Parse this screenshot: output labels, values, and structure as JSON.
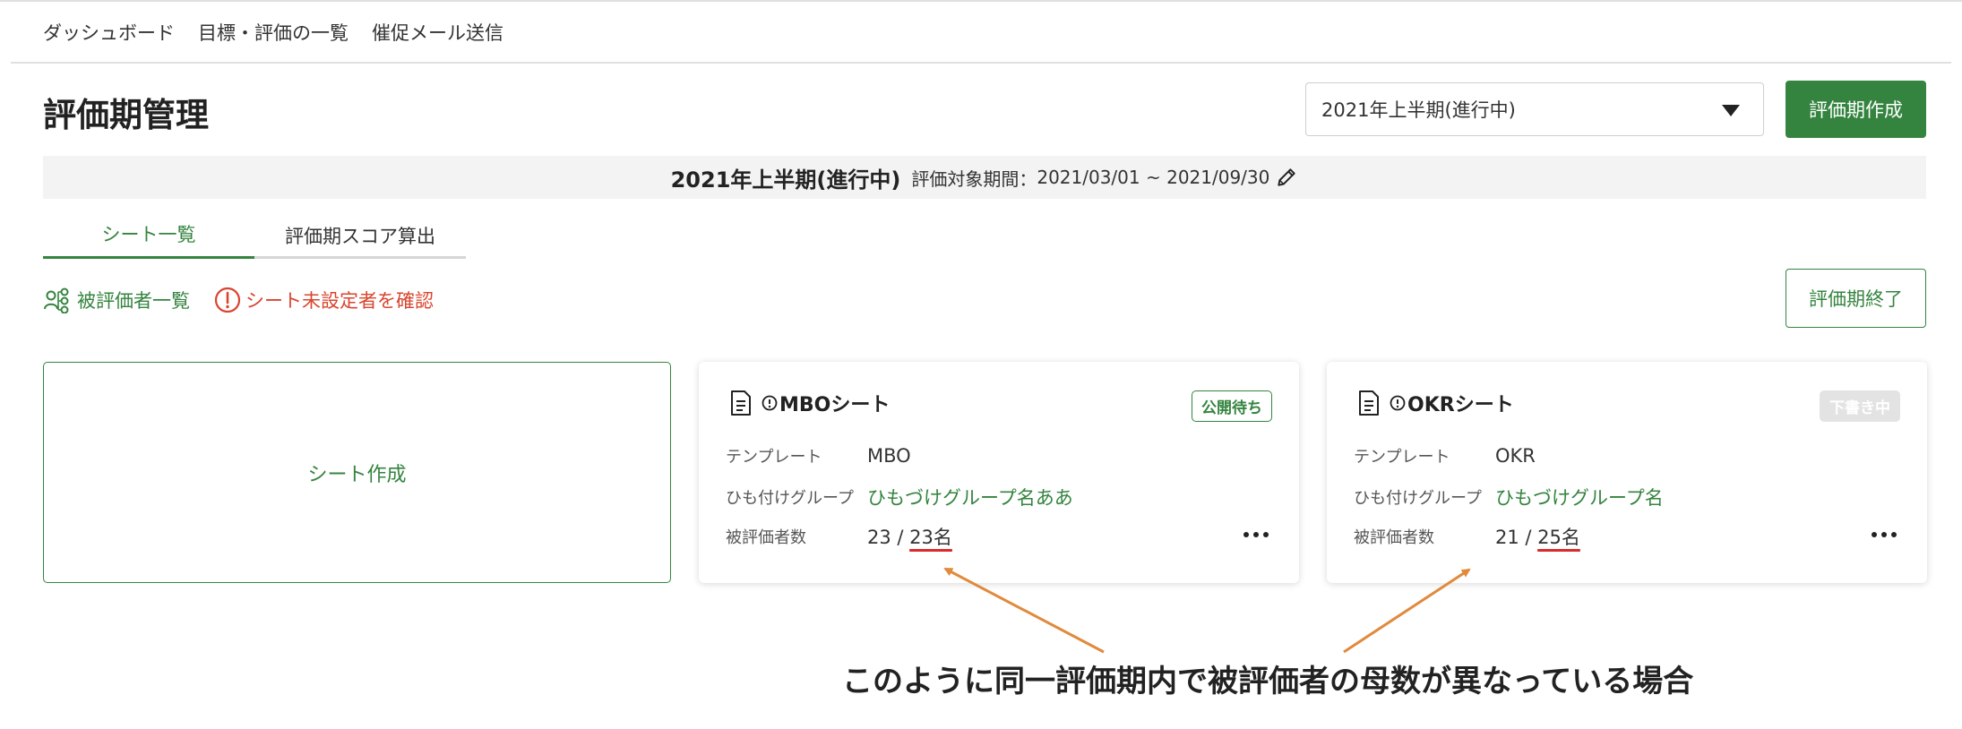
{
  "nav": {
    "items": [
      "ダッシュボード",
      "目標・評価の一覧",
      "催促メール送信"
    ]
  },
  "page": {
    "title": "評価期管理"
  },
  "period_select": {
    "value": "2021年上半期(進行中)"
  },
  "buttons": {
    "create_period": "評価期作成",
    "end_period": "評価期終了"
  },
  "period_info": {
    "name": "2021年上半期(進行中)",
    "range_label": "評価対象期間：",
    "range": "2021/03/01 ~ 2021/09/30"
  },
  "tabs": [
    {
      "label": "シート一覧",
      "active": true
    },
    {
      "label": "評価期スコア算出",
      "active": false
    }
  ],
  "links": {
    "evaluatees": "被評価者一覧",
    "unassigned": "シート未設定者を確認"
  },
  "create_sheet": {
    "label": "シート作成"
  },
  "sheets": [
    {
      "title": "MBOシート",
      "status": "公開待ち",
      "template_label": "テンプレート",
      "template": "MBO",
      "group_label": "ひも付けグループ",
      "group": "ひもづけグループ名ああ",
      "count_label": "被評価者数",
      "count_current": "23",
      "count_sep": " / ",
      "count_total": "23名"
    },
    {
      "title": "OKRシート",
      "status": "下書き中",
      "template_label": "テンプレート",
      "template": "OKR",
      "group_label": "ひも付けグループ",
      "group": "ひもづけグループ名",
      "count_label": "被評価者数",
      "count_current": "21",
      "count_sep": " / ",
      "count_total": "25名"
    }
  ],
  "annotation": {
    "text": "このように同一評価期内で被評価者の母数が異なっている場合"
  },
  "colors": {
    "brand_green": "#34843f",
    "warning_red": "#d9452f",
    "annotation_arrow": "#e08a3c",
    "underline_red": "#d92b2b"
  },
  "icons": {
    "pencil": "pencil-icon",
    "users": "users-icon",
    "alert": "alert-circle-icon",
    "document": "document-icon",
    "info": "info-circle-icon",
    "more": "more-dots-icon",
    "caret": "caret-down-icon"
  }
}
